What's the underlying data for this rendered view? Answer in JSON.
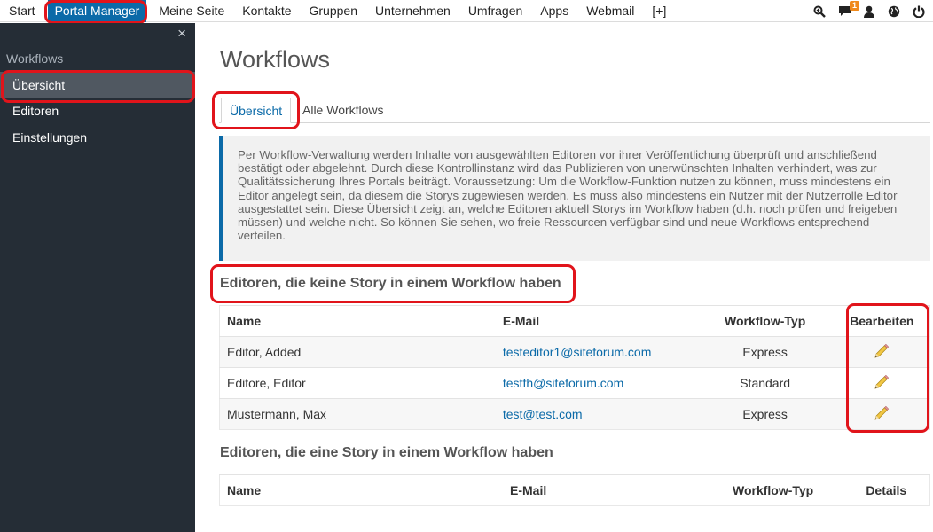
{
  "topnav": {
    "items": [
      "Start",
      "Portal Manager",
      "Meine Seite",
      "Kontakte",
      "Gruppen",
      "Unternehmen",
      "Umfragen",
      "Apps",
      "Webmail",
      "[+]"
    ],
    "active_index": 1,
    "badge_count": "1",
    "icons": [
      "search-icon",
      "chat-icon",
      "user-icon",
      "globe-icon",
      "power-icon"
    ]
  },
  "sidebar": {
    "close_symbol": "×",
    "section_title": "Workflows",
    "items": [
      {
        "label": "Übersicht",
        "active": true
      },
      {
        "label": "Editoren",
        "active": false
      },
      {
        "label": "Einstellungen",
        "active": false
      }
    ]
  },
  "main": {
    "title": "Workflows",
    "tabs": [
      {
        "label": "Übersicht",
        "active": true
      },
      {
        "label": "Alle Workflows",
        "active": false
      }
    ],
    "info_text": "Per Workflow-Verwaltung werden Inhalte von ausgewählten Editoren vor ihrer Veröffentlichung überprüft und anschließend bestätigt oder abgelehnt. Durch diese Kontrollinstanz wird das Publizieren von unerwünschten Inhalten verhindert, was zur Qualitätssicherung Ihres Portals beiträgt. Voraussetzung: Um die Workflow-Funktion nutzen zu können, muss mindestens ein Editor angelegt sein, da diesem die Storys zugewiesen werden. Es muss also mindestens ein Nutzer mit der Nutzerrolle Editor ausgestattet sein. Diese Übersicht zeigt an, welche Editoren aktuell Storys im Workflow haben (d.h. noch prüfen und freigeben müssen) und welche nicht. So können Sie sehen, wo freie Ressourcen verfügbar sind und neue Workflows entsprechend verteilen.",
    "section1": {
      "heading": "Editoren, die keine Story in einem Workflow haben",
      "columns": [
        "Name",
        "E-Mail",
        "Workflow-Typ",
        "Bearbeiten"
      ],
      "rows": [
        {
          "name": "Editor, Added",
          "email": "testeditor1@siteforum.com",
          "type": "Express"
        },
        {
          "name": "Editore, Editor",
          "email": "testfh@siteforum.com",
          "type": "Standard"
        },
        {
          "name": "Mustermann, Max",
          "email": "test@test.com",
          "type": "Express"
        }
      ]
    },
    "section2": {
      "heading": "Editoren, die eine Story in einem Workflow haben",
      "columns": [
        "Name",
        "E-Mail",
        "Workflow-Typ",
        "Details"
      ]
    }
  },
  "colors": {
    "accent": "#0b6aa8",
    "highlight_ring": "#e1141b",
    "sidebar_bg": "#252d36",
    "badge": "#f08a1c"
  }
}
